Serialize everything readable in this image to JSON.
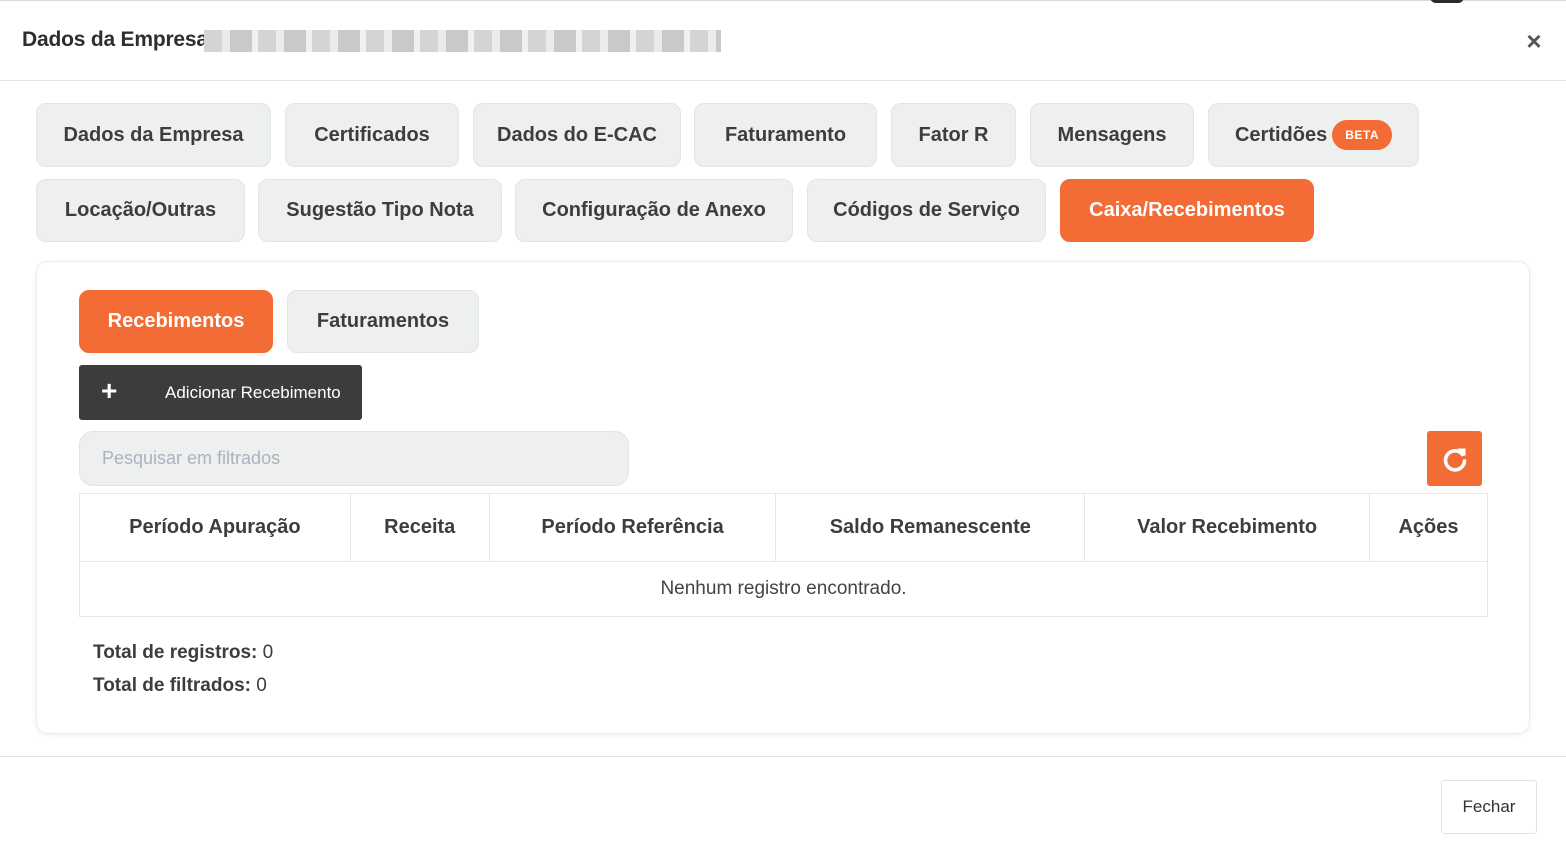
{
  "header": {
    "title": "Dados da Empresa",
    "close_label": "×"
  },
  "tabs": [
    {
      "label": "Dados da Empresa"
    },
    {
      "label": "Certificados"
    },
    {
      "label": "Dados do E-CAC"
    },
    {
      "label": "Faturamento"
    },
    {
      "label": "Fator R"
    },
    {
      "label": "Mensagens"
    },
    {
      "label": "Certidões",
      "badge": "BETA"
    },
    {
      "label": "Locação/Outras"
    },
    {
      "label": "Sugestão Tipo Nota"
    },
    {
      "label": "Configuração de Anexo"
    },
    {
      "label": "Códigos de Serviço"
    },
    {
      "label": "Caixa/Recebimentos",
      "active": true
    }
  ],
  "subtabs": [
    {
      "label": "Recebimentos",
      "active": true
    },
    {
      "label": "Faturamentos"
    }
  ],
  "toolbar": {
    "add_label": "Adicionar Recebimento",
    "search_placeholder": "Pesquisar em filtrados"
  },
  "table": {
    "columns": [
      "Período Apuração",
      "Receita",
      "Período Referência",
      "Saldo Remanescente",
      "Valor Recebimento",
      "Ações"
    ],
    "empty_message": "Nenhum registro encontrado."
  },
  "totals": {
    "records_label": "Total de registros:",
    "records_value": "0",
    "filtered_label": "Total de filtrados:",
    "filtered_value": "0"
  },
  "footer": {
    "close_label": "Fechar"
  },
  "colors": {
    "accent": "#f36b35",
    "dark_button": "#3c3c3c",
    "tab_bg": "#eef0f0"
  }
}
